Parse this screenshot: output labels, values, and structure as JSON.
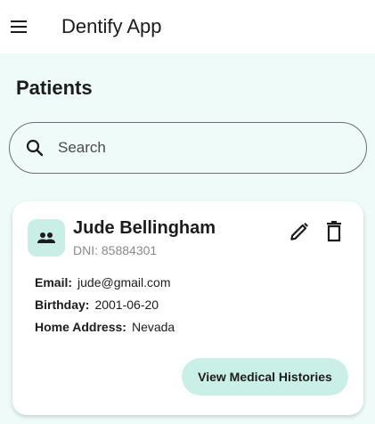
{
  "app_bar": {
    "title": "Dentify App",
    "menu_icon": "hamburger-menu-icon"
  },
  "page": {
    "title": "Patients"
  },
  "search": {
    "placeholder": "Search",
    "value": "",
    "icon": "search-icon"
  },
  "patients": [
    {
      "name": "Jude Bellingham",
      "dni": "DNI: 85884301",
      "avatar_icon": "group-people-icon",
      "email_label": "Email:",
      "email": "jude@gmail.com",
      "birthday_label": "Birthday:",
      "birthday": "2001-06-20",
      "address_label": "Home Address:",
      "address": "Nevada",
      "edit_icon": "pencil-edit-icon",
      "delete_icon": "trash-delete-icon",
      "history_button": "View Medical Histories"
    }
  ],
  "colors": {
    "background": "#eefbf9",
    "app_bar": "#ffffff",
    "card": "#ffffff",
    "accent_light": "#c9efe7",
    "text_primary": "#1c1c1c",
    "text_secondary": "#8a8a8a"
  }
}
